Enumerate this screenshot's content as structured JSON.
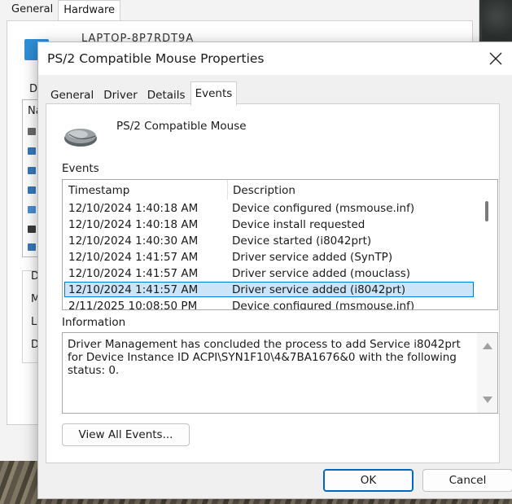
{
  "back_window": {
    "tabs": [
      "General",
      "Hardware"
    ],
    "computer_name": "LAPTOP-8P7RDT9A",
    "side_letters": [
      "D",
      "Na",
      "D",
      "M",
      "L",
      "D"
    ]
  },
  "dialog": {
    "title": "PS/2 Compatible Mouse Properties",
    "tabs": [
      "General",
      "Driver",
      "Details",
      "Events"
    ],
    "active_tab": "Events",
    "device_name": "PS/2 Compatible Mouse",
    "events_label": "Events",
    "columns": {
      "timestamp": "Timestamp",
      "description": "Description"
    },
    "events": [
      {
        "timestamp": "12/10/2024 1:40:18 AM",
        "description": "Device configured (msmouse.inf)"
      },
      {
        "timestamp": "12/10/2024 1:40:18 AM",
        "description": "Device install requested"
      },
      {
        "timestamp": "12/10/2024 1:40:30 AM",
        "description": "Device started (i8042prt)"
      },
      {
        "timestamp": "12/10/2024 1:41:57 AM",
        "description": "Driver service added (SynTP)"
      },
      {
        "timestamp": "12/10/2024 1:41:57 AM",
        "description": "Driver service added (mouclass)"
      },
      {
        "timestamp": "12/10/2024 1:41:57 AM",
        "description": "Driver service added (i8042prt)"
      },
      {
        "timestamp": "2/11/2025 10:08:50 PM",
        "description": "Device configured (msmouse.inf)"
      }
    ],
    "selected_event_index": 5,
    "information_label": "Information",
    "information_text": "Driver Management has concluded the process to add Service i8042prt for Device Instance ID ACPI\\SYN1F10\\4&7BA1676&0 with the following status: 0.",
    "view_all_label": "View All Events...",
    "ok_label": "OK",
    "cancel_label": "Cancel"
  },
  "colors": {
    "selection_fill": "#cce4f7",
    "selection_border": "#0078d7",
    "primary_border": "#0067c0"
  }
}
